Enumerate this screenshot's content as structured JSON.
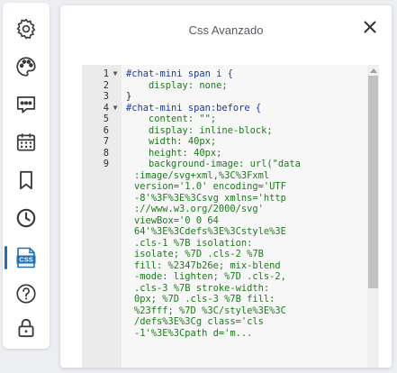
{
  "sidebar": {
    "items": [
      {
        "name": "settings",
        "icon": "gear-icon"
      },
      {
        "name": "theme",
        "icon": "palette-icon"
      },
      {
        "name": "chat",
        "icon": "chat-bubble-icon"
      },
      {
        "name": "calendar",
        "icon": "calendar-icon"
      },
      {
        "name": "bookmark",
        "icon": "bookmark-icon"
      },
      {
        "name": "history",
        "icon": "clock-icon"
      },
      {
        "name": "css",
        "icon": "css-file-icon",
        "label": "CSS",
        "active": true
      },
      {
        "name": "help",
        "icon": "question-icon"
      },
      {
        "name": "lock",
        "icon": "lock-icon"
      }
    ],
    "active_color": "#1f6fb2"
  },
  "panel": {
    "title": "Css Avanzado",
    "close_icon": "close-icon"
  },
  "editor": {
    "lines": [
      {
        "n": "1",
        "fold": "▼",
        "text": "#chat-mini span i {"
      },
      {
        "n": "2",
        "fold": "",
        "text": "    display: none;"
      },
      {
        "n": "3",
        "fold": "",
        "text": "}"
      },
      {
        "n": "4",
        "fold": "▼",
        "text": "#chat-mini span:before {"
      },
      {
        "n": "5",
        "fold": "",
        "text": "    content: \"\";"
      },
      {
        "n": "6",
        "fold": "",
        "text": "    display: inline-block;"
      },
      {
        "n": "7",
        "fold": "",
        "text": "    width: 40px;"
      },
      {
        "n": "8",
        "fold": "",
        "text": "    height: 40px;"
      },
      {
        "n": "9",
        "fold": "",
        "text": "    background-image: url(\"data"
      }
    ],
    "wrapped": [
      ":image/svg+xml,%3C%3Fxml",
      "version='1.0' encoding='UTF",
      "-8'%3F%3E%3Csvg xmlns='http",
      "://www.w3.org/2000/svg'",
      "viewBox='0 0 64",
      "64'%3E%3Cdefs%3E%3Cstyle%3E",
      ".cls-1 %7B isolation:",
      "isolate; %7D .cls-2 %7B",
      "fill: %2347b26e; mix-blend",
      "-mode: lighten; %7D .cls-2,",
      ".cls-3 %7B stroke-width:",
      "0px; %7D .cls-3 %7B fill:",
      "%23fff; %7D %3C/style%3E%3C",
      "/defs%3E%3Cg class='cls",
      "-1'%3E%3Cpath d='m..."
    ]
  }
}
